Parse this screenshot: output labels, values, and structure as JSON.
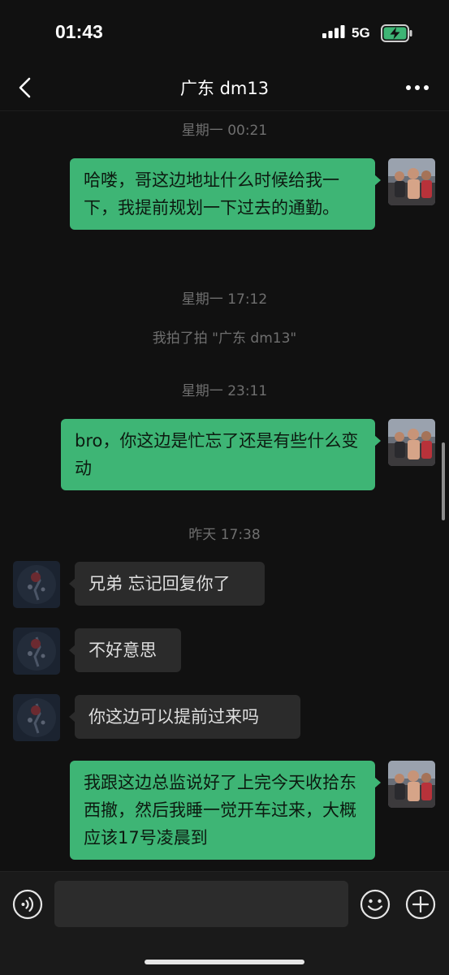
{
  "status_bar": {
    "time": "01:43",
    "network": "5G",
    "icons": [
      "signal-icon",
      "battery-charging-icon"
    ],
    "battery_color": "#3eb575"
  },
  "header": {
    "title": "广东 dm13",
    "icons": [
      "back-arrow-icon",
      "more-icon"
    ]
  },
  "messages": [
    {
      "type": "timestamp",
      "text": "星期一 00:21"
    },
    {
      "type": "message",
      "from": "me",
      "text": "哈喽，哥这边地址什么时候给我一下，我提前规划一下过去的通勤。"
    },
    {
      "type": "timestamp",
      "text": "星期一 17:12"
    },
    {
      "type": "system",
      "text": "我拍了拍 \"广东 dm13\""
    },
    {
      "type": "timestamp",
      "text": "星期一 23:11"
    },
    {
      "type": "message",
      "from": "me",
      "text": "bro，你这边是忙忘了还是有些什么变动"
    },
    {
      "type": "timestamp",
      "text": "昨天 17:38"
    },
    {
      "type": "message",
      "from": "other",
      "text": "兄弟 忘记回复你了"
    },
    {
      "type": "message",
      "from": "other",
      "text": "不好意思"
    },
    {
      "type": "message",
      "from": "other",
      "text": "你这边可以提前过来吗"
    },
    {
      "type": "message",
      "from": "me",
      "text": "我跟这边总监说好了上完今天收拾东西撤，然后我睡一觉开车过来，大概应该17号凌晨到"
    }
  ],
  "input_bar": {
    "value": "",
    "icons": [
      "voice-icon",
      "emoji-icon",
      "plus-icon"
    ]
  },
  "colors": {
    "background": "#111111",
    "my_bubble": "#3eb575",
    "their_bubble": "#2b2b2b",
    "timestamp_text": "#6f6f6f"
  }
}
